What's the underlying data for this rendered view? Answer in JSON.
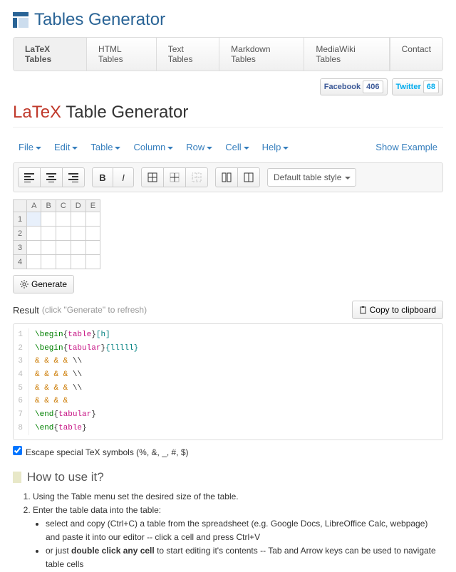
{
  "brand": "Tables Generator",
  "tabs": [
    "LaTeX Tables",
    "HTML Tables",
    "Text Tables",
    "Markdown Tables",
    "MediaWiki Tables"
  ],
  "contact": "Contact",
  "social": {
    "fb": "Facebook",
    "fbCount": "406",
    "tw": "Twitter",
    "twCount": "68"
  },
  "title": {
    "red": "LaTeX",
    "rest": " Table Generator"
  },
  "menu": [
    "File",
    "Edit",
    "Table",
    "Column",
    "Row",
    "Cell",
    "Help"
  ],
  "showExample": "Show Example",
  "styleSelect": "Default table style",
  "gridCols": [
    "A",
    "B",
    "C",
    "D",
    "E"
  ],
  "gridRows": [
    "1",
    "2",
    "3",
    "4"
  ],
  "generate": "Generate",
  "resultLabel": "Result",
  "resultHint": "(click \"Generate\" to refresh)",
  "copy": "Copy to clipboard",
  "code": [
    [
      {
        "t": "\\begin",
        "c": "c-cmd"
      },
      {
        "t": "{"
      },
      {
        "t": "table",
        "c": "c-env"
      },
      {
        "t": "}"
      },
      {
        "t": "[h]",
        "c": "c-arg"
      }
    ],
    [
      {
        "t": "\\begin",
        "c": "c-cmd"
      },
      {
        "t": "{"
      },
      {
        "t": "tabular",
        "c": "c-env"
      },
      {
        "t": "}"
      },
      {
        "t": "{lllll}",
        "c": "c-arg"
      }
    ],
    [
      {
        "t": " ",
        "c": ""
      },
      {
        "t": "&",
        "c": "c-amp"
      },
      {
        "t": "  "
      },
      {
        "t": "&",
        "c": "c-amp"
      },
      {
        "t": "  "
      },
      {
        "t": "&",
        "c": "c-amp"
      },
      {
        "t": "  "
      },
      {
        "t": "&",
        "c": "c-amp"
      },
      {
        "t": "  \\\\"
      }
    ],
    [
      {
        "t": " ",
        "c": ""
      },
      {
        "t": "&",
        "c": "c-amp"
      },
      {
        "t": "  "
      },
      {
        "t": "&",
        "c": "c-amp"
      },
      {
        "t": "  "
      },
      {
        "t": "&",
        "c": "c-amp"
      },
      {
        "t": "  "
      },
      {
        "t": "&",
        "c": "c-amp"
      },
      {
        "t": "  \\\\"
      }
    ],
    [
      {
        "t": " ",
        "c": ""
      },
      {
        "t": "&",
        "c": "c-amp"
      },
      {
        "t": "  "
      },
      {
        "t": "&",
        "c": "c-amp"
      },
      {
        "t": "  "
      },
      {
        "t": "&",
        "c": "c-amp"
      },
      {
        "t": "  "
      },
      {
        "t": "&",
        "c": "c-amp"
      },
      {
        "t": "  \\\\"
      }
    ],
    [
      {
        "t": " ",
        "c": ""
      },
      {
        "t": "&",
        "c": "c-amp"
      },
      {
        "t": "  "
      },
      {
        "t": "&",
        "c": "c-amp"
      },
      {
        "t": "  "
      },
      {
        "t": "&",
        "c": "c-amp"
      },
      {
        "t": "  "
      },
      {
        "t": "&",
        "c": "c-amp"
      },
      {
        "t": " "
      }
    ],
    [
      {
        "t": "\\end",
        "c": "c-cmd"
      },
      {
        "t": "{"
      },
      {
        "t": "tabular",
        "c": "c-env"
      },
      {
        "t": "}"
      }
    ],
    [
      {
        "t": "\\end",
        "c": "c-cmd"
      },
      {
        "t": "{"
      },
      {
        "t": "table",
        "c": "c-env"
      },
      {
        "t": "}"
      }
    ]
  ],
  "escapeLabel": "Escape special TeX symbols (%, &, _, #, $)",
  "howto": "How to use it?",
  "steps": {
    "s1": "Using the Table menu set the desired size of the table.",
    "s2": "Enter the table data into the table:",
    "s2a": "select and copy (Ctrl+C) a table from the spreadsheet (e.g. Google Docs, LibreOffice Calc, webpage) and paste it into our editor -- click a cell and press Ctrl+V",
    "s2b_pre": "or just ",
    "s2b_bold": "double click any cell",
    "s2b_post": " to start editing it's contents -- Tab and Arrow keys can be used to navigate table cells"
  }
}
